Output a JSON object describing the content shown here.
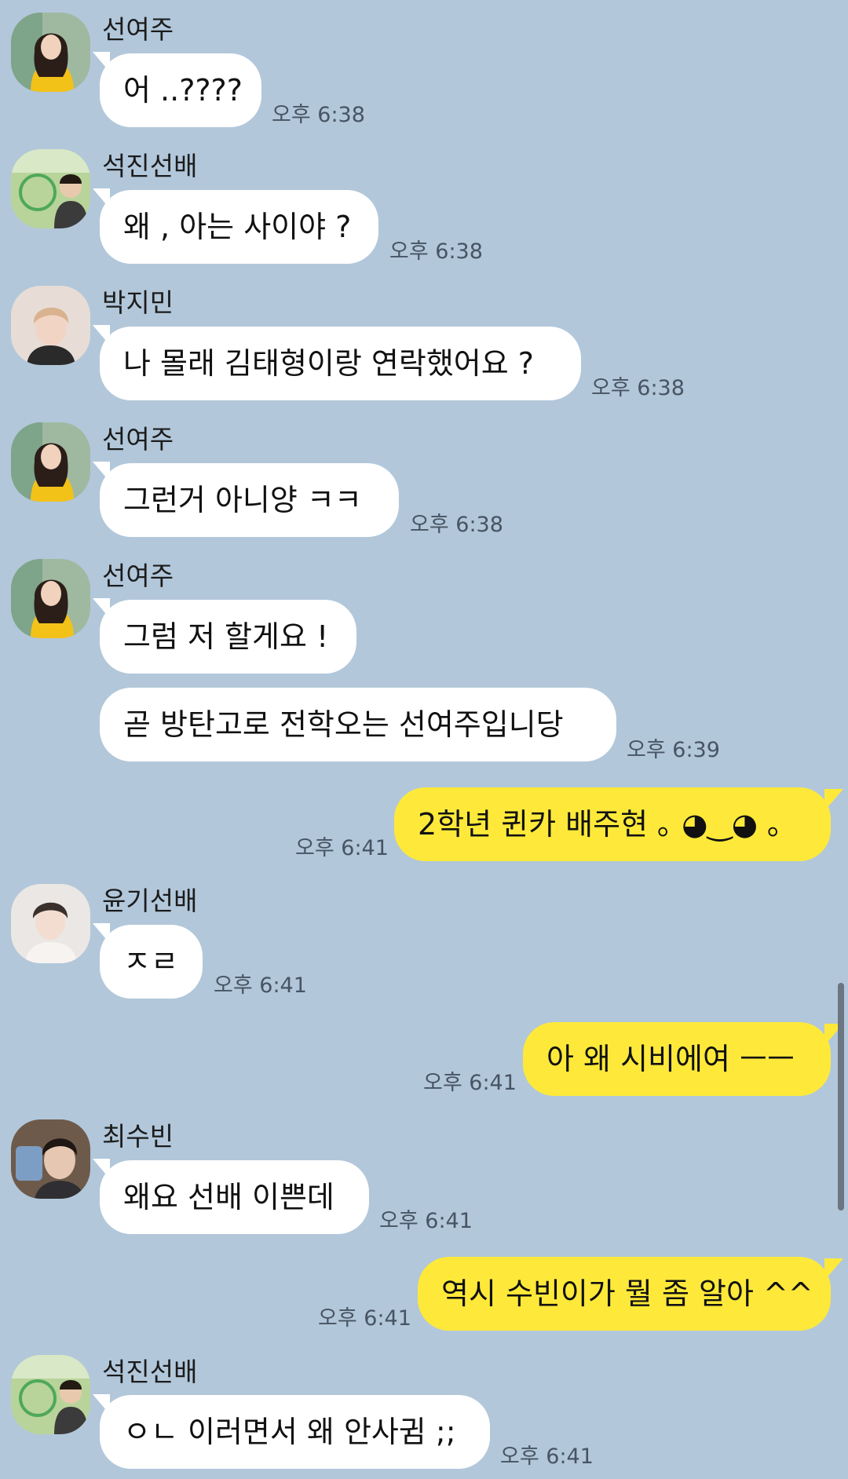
{
  "chat": {
    "background_color": "#b2c7da",
    "incoming_bubble_color": "#ffffff",
    "outgoing_bubble_color": "#fee93a",
    "messages": [
      {
        "sender": "선여주",
        "text": "어 ..????",
        "time": "오후 6:38",
        "avatar": "sun-yeoju-avatar"
      },
      {
        "sender": "석진선배",
        "text": "왜 , 아는 사이야 ?",
        "time": "오후 6:38",
        "avatar": "seokjin-avatar"
      },
      {
        "sender": "박지민",
        "text": "나 몰래 김태형이랑 연락했어요 ?",
        "time": "오후 6:38",
        "avatar": "jimin-avatar"
      },
      {
        "sender": "선여주",
        "text": "그런거 아니양 ㅋㅋ",
        "time": "오후 6:38",
        "avatar": "sun-yeoju-avatar"
      },
      {
        "sender": "선여주",
        "text": "그럼 저 할게요 !",
        "time": "",
        "avatar": "sun-yeoju-avatar"
      },
      {
        "sender": "",
        "text": "곧 방탄고로 전학오는 선여주입니당",
        "time": "오후 6:39"
      },
      {
        "sender": "me",
        "text": "2학년 퀸카 배주현 ｡ ◕‿◕ ｡",
        "time": "오후 6:41"
      },
      {
        "sender": "윤기선배",
        "text": "ㅈㄹ",
        "time": "오후 6:41",
        "avatar": "yoongi-avatar"
      },
      {
        "sender": "me",
        "text": "아 왜 시비에여 ㅡㅡ",
        "time": "오후 6:41"
      },
      {
        "sender": "최수빈",
        "text": "왜요 선배 이쁜데",
        "time": "오후 6:41",
        "avatar": "soobin-avatar"
      },
      {
        "sender": "me",
        "text": "역시 수빈이가 뭘 좀 알아 ^^",
        "time": "오후 6:41"
      },
      {
        "sender": "석진선배",
        "text": "ㅇㄴ 이러면서 왜 안사귐 ;;",
        "time": "오후 6:41",
        "avatar": "seokjin-avatar"
      }
    ]
  }
}
